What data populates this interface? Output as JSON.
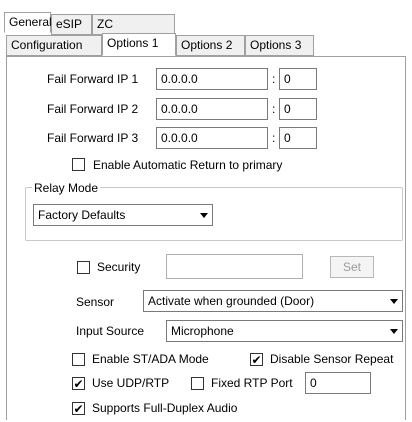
{
  "top_tabs": [
    "General",
    "eSIP",
    "ZC"
  ],
  "sub_tabs": [
    "Configuration",
    "Options 1",
    "Options 2",
    "Options 3"
  ],
  "fail_forward": [
    {
      "label": "Fail Forward IP 1",
      "ip": "0.0.0.0",
      "sep": ":",
      "port": "0"
    },
    {
      "label": "Fail Forward IP 2",
      "ip": "0.0.0.0",
      "sep": ":",
      "port": "0"
    },
    {
      "label": "Fail Forward IP 3",
      "ip": "0.0.0.0",
      "sep": ":",
      "port": "0"
    }
  ],
  "enable_auto_return": {
    "label": "Enable Automatic Return to primary",
    "checked": false
  },
  "relay_mode": {
    "group_label": "Relay Mode",
    "value": "Factory Defaults"
  },
  "security": {
    "label": "Security",
    "checked": false,
    "value": "",
    "set_label": "Set"
  },
  "sensor": {
    "label": "Sensor",
    "value": "Activate when grounded (Door)"
  },
  "input_source": {
    "label": "Input Source",
    "value": "Microphone"
  },
  "checkboxes": {
    "st_ada": {
      "label": "Enable ST/ADA Mode",
      "checked": false
    },
    "disable_sensor_repeat": {
      "label": "Disable Sensor Repeat",
      "checked": true
    },
    "use_udp_rtp": {
      "label": "Use UDP/RTP",
      "checked": true
    },
    "fixed_rtp_port": {
      "label": "Fixed RTP Port",
      "checked": false,
      "value": "0"
    },
    "full_duplex": {
      "label": "Supports Full-Duplex Audio",
      "checked": true
    }
  },
  "check_glyph": "✔"
}
